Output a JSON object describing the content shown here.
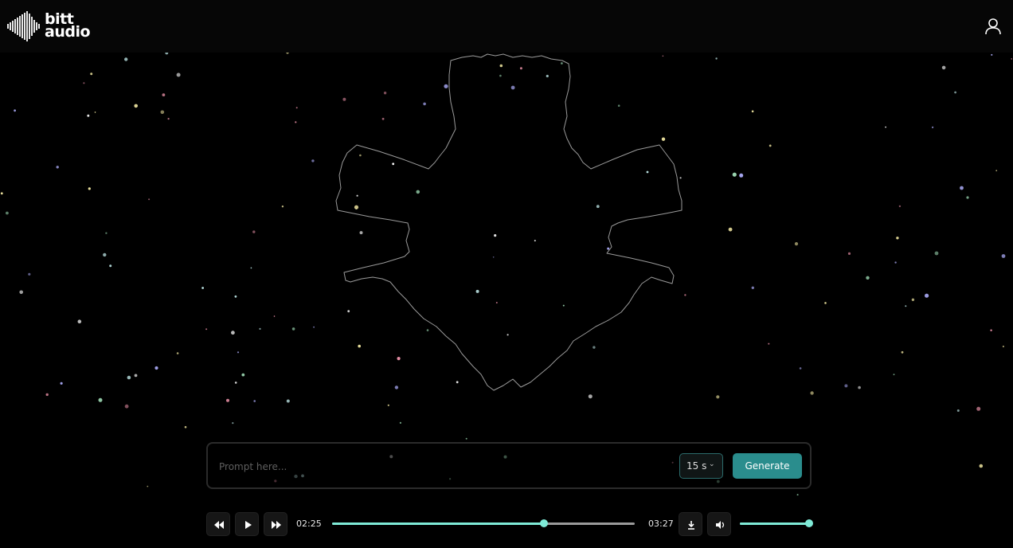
{
  "app": {
    "logo_line1": "bitt",
    "logo_line2": "audio"
  },
  "header": {
    "user_icon": "user-icon"
  },
  "prompt": {
    "placeholder": "Prompt here...",
    "value": "",
    "duration_value": "15 s",
    "generate_label": "Generate"
  },
  "player": {
    "current_time": "02:25",
    "total_time": "03:27",
    "progress": 0.7,
    "volume": 1.0
  },
  "colors": {
    "accent": "#7fead7",
    "button": "#2a8d8d",
    "track_bg": "#9a9a9a",
    "star_colors": [
      "#bfe8e8",
      "#e88fa5",
      "#9ad6b0",
      "#a6a6f0",
      "#f0e6a0",
      "#ffffff"
    ]
  }
}
